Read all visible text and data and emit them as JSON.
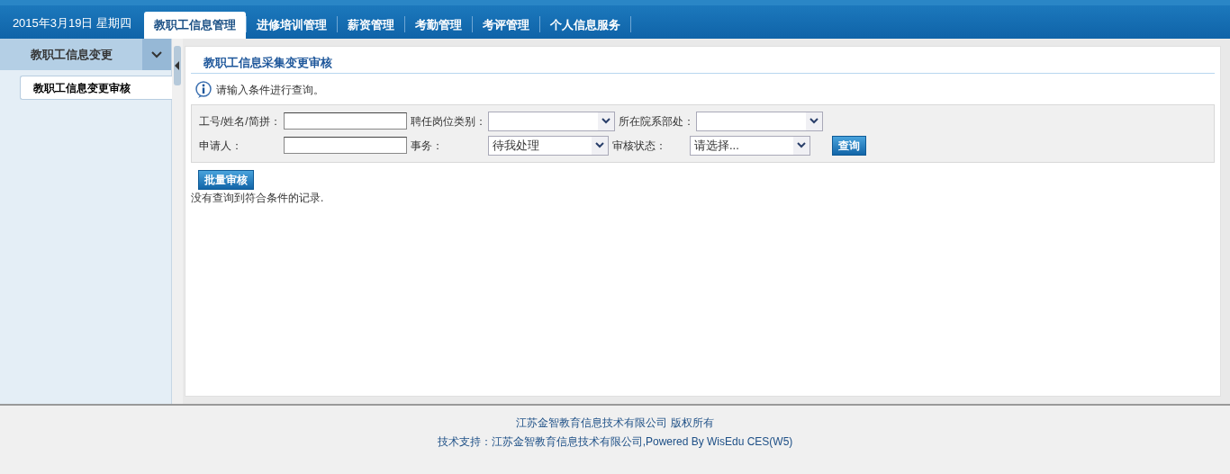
{
  "header": {
    "date": "2015年3月19日 星期四"
  },
  "tabs": [
    {
      "label": "教职工信息管理",
      "selected": true
    },
    {
      "label": "进修培训管理",
      "selected": false
    },
    {
      "label": "薪资管理",
      "selected": false
    },
    {
      "label": "考勤管理",
      "selected": false
    },
    {
      "label": "考评管理",
      "selected": false
    },
    {
      "label": "个人信息服务",
      "selected": false
    }
  ],
  "sidebar": {
    "group": {
      "label": "教职工信息变更",
      "expanded": true
    },
    "items": [
      {
        "label": "教职工信息变更审核",
        "selected": true
      }
    ]
  },
  "panel": {
    "title": "教职工信息采集变更审核",
    "hint": "请输入条件进行查询。",
    "filters": [
      [
        {
          "kind": "text",
          "label": "工号/姓名/简拼："
        },
        {
          "kind": "select",
          "label": "聘任岗位类别："
        },
        {
          "kind": "select",
          "label": "所在院系部处："
        }
      ],
      [
        {
          "kind": "text",
          "label": "申请人："
        },
        {
          "kind": "select",
          "label": "事务：",
          "value": "待我处理"
        },
        {
          "kind": "select",
          "label": "审核状态：",
          "value": "请选择..."
        }
      ]
    ],
    "search_button": "查询",
    "batch_button": "批量审核",
    "empty_message": "没有查询到符合条件的记录."
  },
  "footer": {
    "copyright": "江苏金智教育信息技术有限公司 版权所有",
    "support": "技术支持：江苏金智教育信息技术有限公司,Powered By WisEdu CES(W5)"
  }
}
